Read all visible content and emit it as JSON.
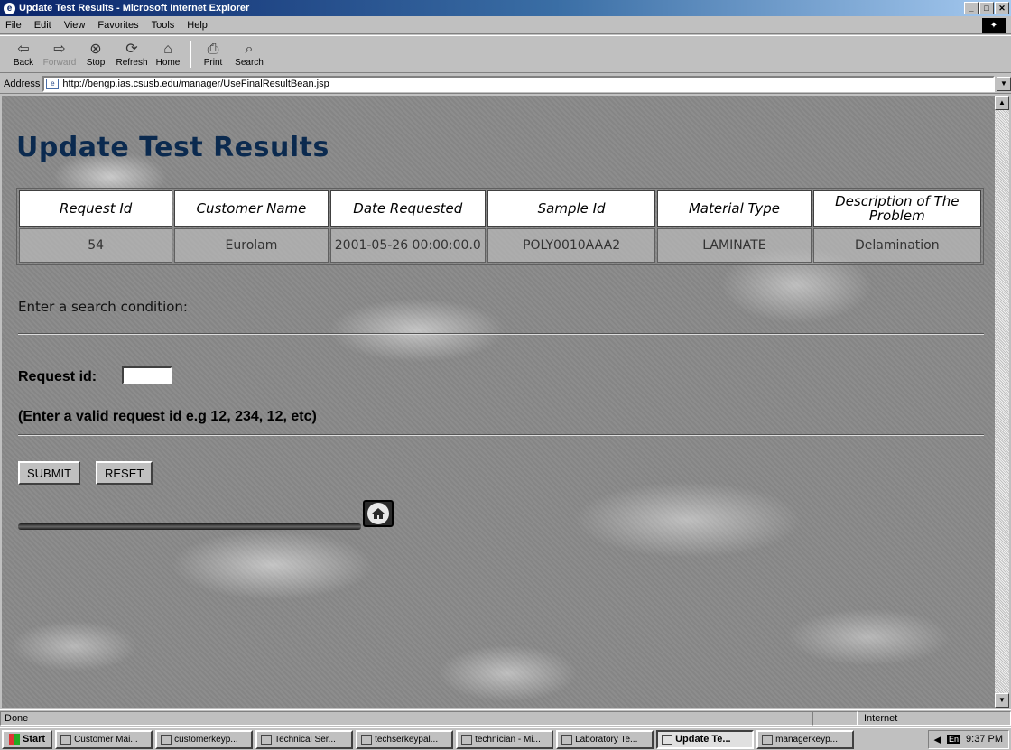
{
  "window": {
    "title": "Update Test Results - Microsoft Internet Explorer",
    "controls": [
      "_",
      "□",
      "✕"
    ]
  },
  "menu": [
    "File",
    "Edit",
    "View",
    "Favorites",
    "Tools",
    "Help"
  ],
  "toolbar": {
    "back": "Back",
    "forward": "Forward",
    "stop": "Stop",
    "refresh": "Refresh",
    "home": "Home",
    "print": "Print",
    "search": "Search"
  },
  "address": {
    "label": "Address",
    "url": "http://bengp.ias.csusb.edu/manager/UseFinalResultBean.jsp"
  },
  "page": {
    "title": "Update Test Results",
    "table": {
      "headers": [
        "Request Id",
        "Customer Name",
        "Date Requested",
        "Sample Id",
        "Material Type",
        "Description of The Problem"
      ],
      "rows": [
        [
          "54",
          "Eurolam",
          "2001-05-26 00:00:00.0",
          "POLY0010AAA2",
          "LAMINATE",
          "Delamination"
        ]
      ]
    },
    "search_prompt": "Enter a search condition:",
    "request_label": "Request id:",
    "request_value": "",
    "hint": "(Enter a valid request id e.g 12, 234, 12, etc)",
    "submit_label": "SUBMIT",
    "reset_label": "RESET"
  },
  "status": {
    "left": "Done",
    "zone": "Internet"
  },
  "taskbar": {
    "start": "Start",
    "tasks": [
      "Customer Mai...",
      "customerkeyp...",
      "Technical Ser...",
      "techserkeypal...",
      "technician - Mi...",
      "Laboratory Te...",
      "Update Te...",
      "managerkeyp..."
    ],
    "active_index": 6,
    "lang": "En",
    "clock": "9:37 PM"
  }
}
